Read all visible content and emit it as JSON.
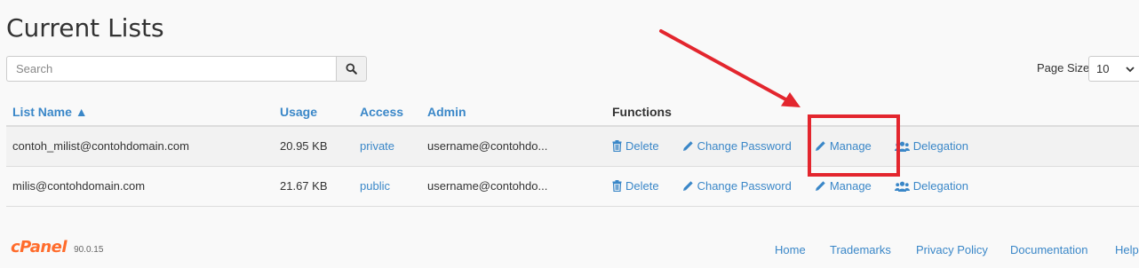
{
  "header": {
    "title": "Current Lists"
  },
  "search": {
    "placeholder": "Search"
  },
  "page_size": {
    "label": "Page Size",
    "value": "10"
  },
  "table": {
    "columns": {
      "list_name": "List Name ▲",
      "usage": "Usage",
      "access": "Access",
      "admin": "Admin",
      "functions": "Functions"
    },
    "rows": [
      {
        "list_name": "contoh_milist@contohdomain.com",
        "usage": "20.95 KB",
        "access": "private",
        "admin": "username@contohdo..."
      },
      {
        "list_name": "milis@contohdomain.com",
        "usage": "21.67 KB",
        "access": "public",
        "admin": "username@contohdo..."
      }
    ],
    "functions": {
      "delete": "Delete",
      "change_password": "Change Password",
      "manage": "Manage",
      "delegation": "Delegation"
    }
  },
  "colors": {
    "link": "#3a87c8",
    "annotation": "#e3262e",
    "brand": "#ff6c2c"
  },
  "footer": {
    "brand": "cPanel",
    "version": "90.0.15",
    "links": [
      "Home",
      "Trademarks",
      "Privacy Policy",
      "Documentation",
      "Help"
    ]
  }
}
